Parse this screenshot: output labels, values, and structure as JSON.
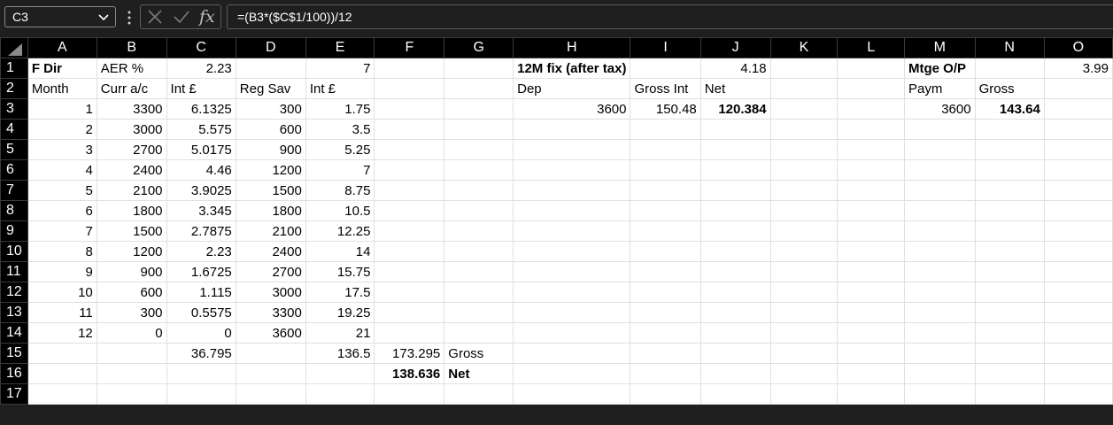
{
  "formula_bar": {
    "name_box": "C3",
    "formula": "=(B3*($C$1/100))/12",
    "fx_label": "fx"
  },
  "icons": {
    "name_box_dropdown": "chevron-down-icon",
    "more": "vertical-dots-icon",
    "cancel": "cross-icon",
    "enter": "check-icon",
    "select_all": "select-all-triangle-icon"
  },
  "columns": [
    "A",
    "B",
    "C",
    "D",
    "E",
    "F",
    "G",
    "H",
    "I",
    "J",
    "K",
    "L",
    "M",
    "N",
    "O"
  ],
  "rows": [
    {
      "n": "1",
      "cells": {
        "A": "F Dir",
        "B": "AER %",
        "C": "2.23",
        "E": "7",
        "H": "12M fix (after tax)",
        "J": "4.18",
        "M": "Mtge O/P",
        "O": "3.99"
      }
    },
    {
      "n": "2",
      "cells": {
        "A": "Month",
        "B": "Curr a/c",
        "C": "Int £",
        "D": "Reg Sav",
        "E": "Int £",
        "H": "Dep",
        "I": "Gross Int",
        "J": "Net",
        "M": "Paym",
        "N": "Gross"
      }
    },
    {
      "n": "3",
      "cells": {
        "A": "1",
        "B": "3300",
        "C": "6.1325",
        "D": "300",
        "E": "1.75",
        "H": "3600",
        "I": "150.48",
        "J": "120.384",
        "M": "3600",
        "N": "143.64"
      }
    },
    {
      "n": "4",
      "cells": {
        "A": "2",
        "B": "3000",
        "C": "5.575",
        "D": "600",
        "E": "3.5"
      }
    },
    {
      "n": "5",
      "cells": {
        "A": "3",
        "B": "2700",
        "C": "5.0175",
        "D": "900",
        "E": "5.25"
      }
    },
    {
      "n": "6",
      "cells": {
        "A": "4",
        "B": "2400",
        "C": "4.46",
        "D": "1200",
        "E": "7"
      }
    },
    {
      "n": "7",
      "cells": {
        "A": "5",
        "B": "2100",
        "C": "3.9025",
        "D": "1500",
        "E": "8.75"
      }
    },
    {
      "n": "8",
      "cells": {
        "A": "6",
        "B": "1800",
        "C": "3.345",
        "D": "1800",
        "E": "10.5"
      }
    },
    {
      "n": "9",
      "cells": {
        "A": "7",
        "B": "1500",
        "C": "2.7875",
        "D": "2100",
        "E": "12.25"
      }
    },
    {
      "n": "10",
      "cells": {
        "A": "8",
        "B": "1200",
        "C": "2.23",
        "D": "2400",
        "E": "14"
      }
    },
    {
      "n": "11",
      "cells": {
        "A": "9",
        "B": "900",
        "C": "1.6725",
        "D": "2700",
        "E": "15.75"
      }
    },
    {
      "n": "12",
      "cells": {
        "A": "10",
        "B": "600",
        "C": "1.115",
        "D": "3000",
        "E": "17.5"
      }
    },
    {
      "n": "13",
      "cells": {
        "A": "11",
        "B": "300",
        "C": "0.5575",
        "D": "3300",
        "E": "19.25"
      }
    },
    {
      "n": "14",
      "cells": {
        "A": "12",
        "B": "0",
        "C": "0",
        "D": "3600",
        "E": "21"
      }
    },
    {
      "n": "15",
      "cells": {
        "C": "36.795",
        "E": "136.5",
        "F": "173.295",
        "G": "Gross"
      }
    },
    {
      "n": "16",
      "cells": {
        "F": "138.636",
        "G": "Net"
      }
    },
    {
      "n": "17",
      "cells": {}
    }
  ],
  "right_aligned": [
    "A3",
    "A4",
    "A5",
    "A6",
    "A7",
    "A8",
    "A9",
    "A10",
    "A11",
    "A12",
    "A13",
    "A14",
    "B3",
    "B4",
    "B5",
    "B6",
    "B7",
    "B8",
    "B9",
    "B10",
    "B11",
    "B12",
    "B13",
    "B14",
    "C1",
    "C3",
    "C4",
    "C5",
    "C6",
    "C7",
    "C8",
    "C9",
    "C10",
    "C11",
    "C12",
    "C13",
    "C14",
    "C15",
    "D3",
    "D4",
    "D5",
    "D6",
    "D7",
    "D8",
    "D9",
    "D10",
    "D11",
    "D12",
    "D13",
    "D14",
    "E1",
    "E3",
    "E4",
    "E5",
    "E6",
    "E7",
    "E8",
    "E9",
    "E10",
    "E11",
    "E12",
    "E13",
    "E14",
    "E15",
    "F15",
    "F16",
    "H3",
    "I3",
    "J1",
    "J3",
    "M3",
    "N3",
    "O1"
  ],
  "bold_cells": [
    "A1",
    "H1",
    "J3",
    "M1",
    "N3",
    "F16",
    "G16"
  ],
  "colors": {
    "app_background": "#1f1f1f",
    "header_background": "#000000",
    "grid_line": "#e0e0e0",
    "cell_background": "#ffffff"
  }
}
